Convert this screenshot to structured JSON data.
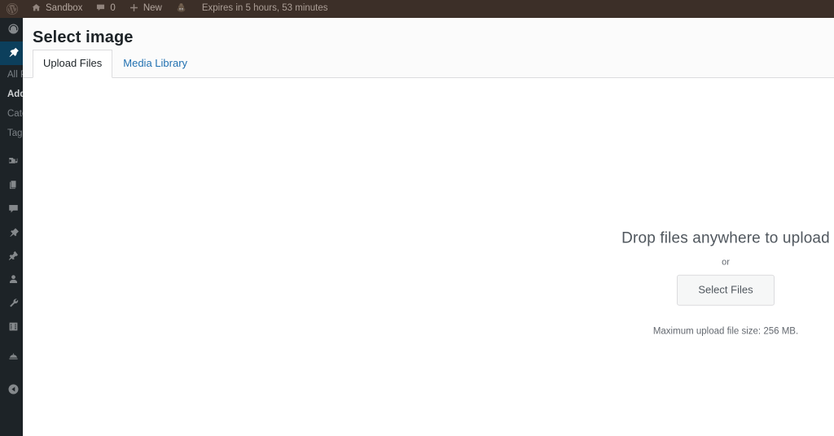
{
  "adminbar": {
    "logo_icon": "wordpress-logo-icon",
    "items": [
      {
        "icon": "home-icon",
        "glyph": "⌂",
        "label": "Sandbox",
        "name": "site-name"
      },
      {
        "icon": "comment-bubble-icon",
        "glyph": "▭",
        "label": "0",
        "name": "comments-count"
      },
      {
        "icon": "plus-icon",
        "glyph": "＋",
        "label": "New",
        "name": "new-content"
      },
      {
        "icon": "avatar-icon",
        "glyph": "●",
        "label": "",
        "name": "user-avatar"
      }
    ],
    "expires_text": "Expires in 5 hours, 53 minutes"
  },
  "sidebar": {
    "items": [
      {
        "label": "Dashboard",
        "icon": "dashboard-gauge-icon",
        "glyph": "◔",
        "current": false
      },
      {
        "label": "Posts",
        "icon": "pushpin-icon",
        "glyph": "✒",
        "current": true
      }
    ],
    "submenu": [
      {
        "label": "All Posts",
        "selected": false
      },
      {
        "label": "Add New",
        "selected": true
      },
      {
        "label": "Categories",
        "selected": false
      },
      {
        "label": "Tags",
        "selected": false
      }
    ],
    "items_lower": [
      {
        "label": "Media",
        "icon": "media-camera-icon",
        "glyph": "♫"
      },
      {
        "label": "Pages",
        "icon": "pages-document-icon",
        "glyph": "▧"
      },
      {
        "label": "Comments",
        "icon": "comment-bubble-icon",
        "glyph": "▮"
      },
      {
        "label": "Appearance",
        "icon": "paintbrush-icon",
        "glyph": "✒"
      },
      {
        "label": "Plugins",
        "icon": "plug-icon",
        "glyph": "⚡"
      },
      {
        "label": "Users",
        "icon": "user-icon",
        "glyph": "♟"
      },
      {
        "label": "Tools",
        "icon": "wrench-icon",
        "glyph": "⚒"
      },
      {
        "label": "Settings",
        "icon": "settings-sliders-icon",
        "glyph": "⚙"
      },
      {
        "label": "Hosting",
        "icon": "hosting-dome-icon",
        "glyph": "◗"
      }
    ],
    "collapse": {
      "label": "Collapse menu",
      "icon": "collapse-arrow-icon",
      "glyph": "◀"
    }
  },
  "modal": {
    "title": "Select image",
    "tabs": [
      {
        "label": "Upload Files",
        "active": true
      },
      {
        "label": "Media Library",
        "active": false
      }
    ],
    "uploader": {
      "drop_instructions": "Drop files anywhere to upload",
      "or_label": "or",
      "select_files_label": "Select Files",
      "max_upload_text": "Maximum upload file size: 256 MB."
    }
  },
  "colors": {
    "adminbar_bg": "#3c2f28",
    "sidebar_bg": "#1d2327",
    "current_item_bg": "#0c3f5c",
    "link_blue": "#2271b1",
    "header_bg": "#fbfbfb",
    "border": "#dcdcde"
  }
}
